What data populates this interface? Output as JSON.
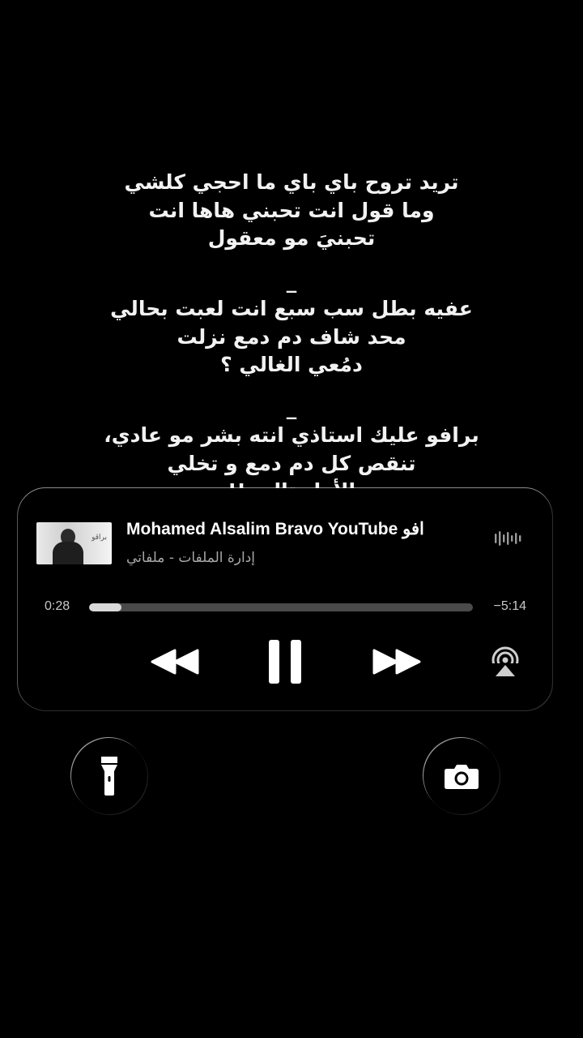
{
  "lyrics": {
    "stanza1": [
      "تريد تروح باي باي ما احجي كلشي",
      "وما قول انت تحبني هاها انت",
      "تحبنيَ مو معقول"
    ],
    "separator1": "_",
    "stanza2": [
      "عفيه بطل سب سبع انت لعبت بحالي",
      "محد شاف دم دمع نزلت",
      "دمُعي الغالي ؟"
    ],
    "separator2": "_",
    "stanza3": [
      "برافو عليك استاذي انته بشر مو عادي،",
      "تنقص كل دم دمع و تخلي",
      "الأول تالي !!"
    ]
  },
  "player": {
    "track_title": "Mohamed Alsalim  Bravo  YouTube  افو",
    "track_subtitle": "إدارة الملفات - ملفاتي",
    "time_elapsed": "0:28",
    "time_remaining": "−5:14",
    "progress_fraction": 0.085,
    "artwork_label": "براڤو",
    "icons": {
      "waveform": "waveform-icon",
      "rewind": "rewind-icon",
      "pause": "pause-icon",
      "forward": "fast-forward-icon",
      "airplay": "airplay-icon"
    }
  },
  "quick_actions": {
    "left_icon": "flashlight-icon",
    "right_icon": "camera-icon"
  },
  "colors": {
    "background": "#000000",
    "text": "#ffffff",
    "subtext": "#a8a8a8",
    "progress_fill": "#d9d9d9",
    "progress_track": "#4a4a4a"
  }
}
